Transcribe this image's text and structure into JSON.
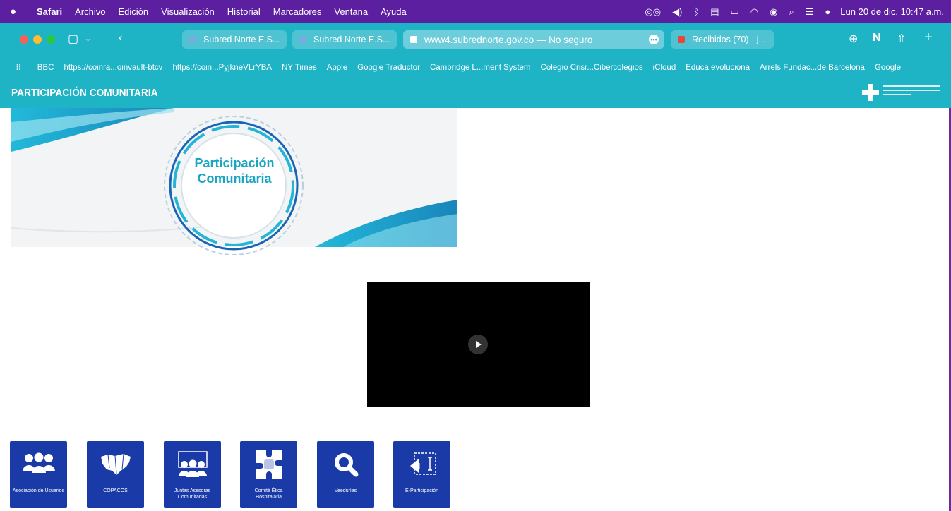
{
  "menubar": {
    "app": "Safari",
    "items": [
      "Archivo",
      "Edición",
      "Visualización",
      "Historial",
      "Marcadores",
      "Ventana",
      "Ayuda"
    ],
    "clock": "Lun 20 de dic. 10:47 a.m."
  },
  "toolbar": {
    "tabs": [
      {
        "label": "Subred Norte E.S..."
      },
      {
        "label": "Subred Norte E.S..."
      },
      {
        "label": "www4.subrednorte.gov.co — No seguro"
      },
      {
        "label": "Recibidos (70) - j..."
      }
    ]
  },
  "bookmarks": [
    "BBC",
    "https://coinra...oinvault-btcv",
    "https://coin...PyjkneVLrYBA",
    "NY Times",
    "Apple",
    "Google Traductor",
    "Cambridge L...ment System",
    "Colegio Crisr...Cibercolegios",
    "iCloud",
    "Educa evoluciona",
    "Arrels Fundac...de Barcelona",
    "Google"
  ],
  "site": {
    "title": "PARTICIPACIÓN COMUNITARIA"
  },
  "banner": {
    "line1": "Participación",
    "line2": "Comunitaria"
  },
  "tiles": [
    {
      "label": "Asociación de Usuarios",
      "icon": "people-group-icon"
    },
    {
      "label": "COPACOS",
      "icon": "map-icon"
    },
    {
      "label": "Juntas Asesoras Comunitarias",
      "icon": "board-people-icon"
    },
    {
      "label": "Comité Ética Hospitalaria",
      "icon": "puzzle-people-icon"
    },
    {
      "label": "Veedurías",
      "icon": "search-icon"
    },
    {
      "label": "E-Participación",
      "icon": "cursor-select-icon"
    }
  ],
  "colors": {
    "menubar": "#5b1fa0",
    "header": "#1fb3c6",
    "tile": "#1a3aa8"
  }
}
